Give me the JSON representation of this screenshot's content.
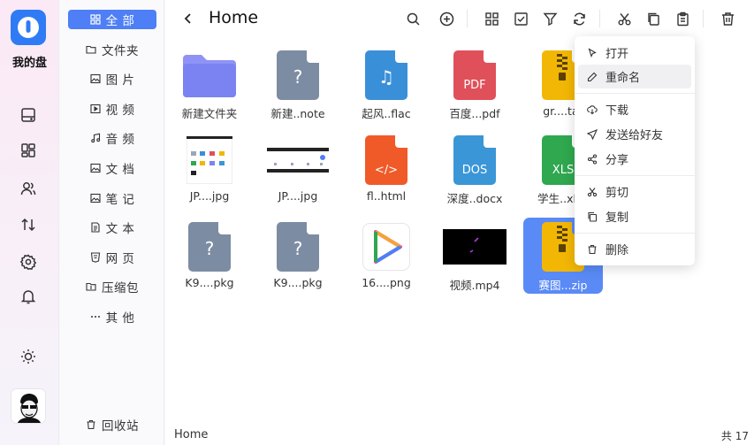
{
  "app": {
    "name": "我的盘"
  },
  "rail": {
    "icons": [
      "drive-icon",
      "dashboard-icon",
      "users-icon",
      "transfer-icon",
      "settings-icon",
      "bell-icon",
      "theme-sun-icon"
    ]
  },
  "categories": [
    {
      "label": "全 部",
      "icon": "grid-icon",
      "active": true
    },
    {
      "label": "文件夹",
      "icon": "folder-icon"
    },
    {
      "label": "图 片",
      "icon": "image-icon"
    },
    {
      "label": "视 频",
      "icon": "video-icon"
    },
    {
      "label": "音 频",
      "icon": "music-icon"
    },
    {
      "label": "文 档",
      "icon": "document-icon"
    },
    {
      "label": "笔 记",
      "icon": "note-icon"
    },
    {
      "label": "文 本",
      "icon": "text-icon"
    },
    {
      "label": "网 页",
      "icon": "html-icon"
    },
    {
      "label": "压缩包",
      "icon": "archive-icon"
    },
    {
      "label": "其 他",
      "icon": "more-icon"
    }
  ],
  "trash": {
    "label": "回收站"
  },
  "header": {
    "title": "Home"
  },
  "toolbar": [
    "search-icon",
    "add-icon",
    "grid-view-icon",
    "select-icon",
    "filter-icon",
    "refresh-icon",
    "cut-icon",
    "copy-icon",
    "paste-icon",
    "delete-icon"
  ],
  "files": [
    {
      "name": "新建文件夹",
      "kind": "folder"
    },
    {
      "name": "新建..note",
      "kind": "doc",
      "color": "#7c8ca3",
      "glyph": "?"
    },
    {
      "name": "起风..flac",
      "kind": "doc",
      "color": "#3a8fd9",
      "glyph": "♫"
    },
    {
      "name": "百度...pdf",
      "kind": "doc",
      "color": "#e0505a",
      "glyph": "PDF"
    },
    {
      "name": "gr....tar",
      "kind": "zip",
      "color": "#f2b705"
    },
    {
      "name": "JP....jpg",
      "kind": "shot1"
    },
    {
      "name": "JP....jpg",
      "kind": "shot2"
    },
    {
      "name": "fl..html",
      "kind": "doc",
      "color": "#f05a28",
      "glyph": "</>"
    },
    {
      "name": "深度..docx",
      "kind": "doc",
      "color": "#3a96d6",
      "glyph": "DOS"
    },
    {
      "name": "学生..xlsx",
      "kind": "doc",
      "color": "#2fa84f",
      "glyph": "XLS"
    },
    {
      "name": "K9....pkg",
      "kind": "doc",
      "color": "#7c8ca3",
      "glyph": "?"
    },
    {
      "name": "K9....pkg",
      "kind": "doc",
      "color": "#7c8ca3",
      "glyph": "?"
    },
    {
      "name": "16....png",
      "kind": "play"
    },
    {
      "name": "视频.mp4",
      "kind": "video"
    },
    {
      "name": "赛图...zip",
      "kind": "zip",
      "color": "#f2b705",
      "selected": true
    }
  ],
  "status": {
    "path": "Home",
    "count": "共 17"
  },
  "context_menu": [
    {
      "label": "打开",
      "icon": "cursor-icon"
    },
    {
      "label": "重命名",
      "icon": "pencil-icon",
      "hover": true
    },
    {
      "label": "下载",
      "icon": "download-icon"
    },
    {
      "label": "发送给好友",
      "icon": "send-icon"
    },
    {
      "label": "分享",
      "icon": "share-icon"
    },
    {
      "label": "剪切",
      "icon": "cut-icon"
    },
    {
      "label": "复制",
      "icon": "copy-icon"
    },
    {
      "label": "删除",
      "icon": "trash-icon"
    }
  ]
}
